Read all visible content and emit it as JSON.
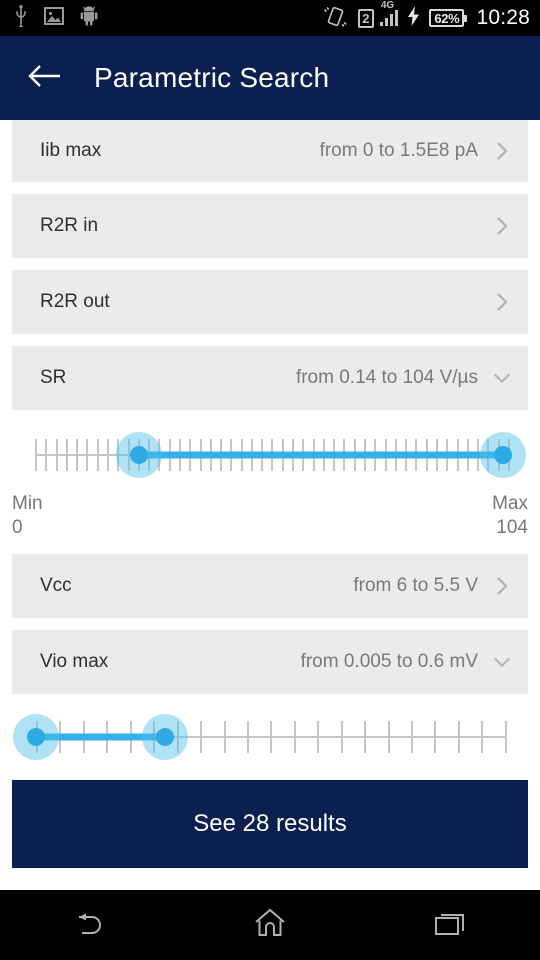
{
  "status_bar": {
    "left_icons": [
      "usb-icon",
      "screenshot-image-icon",
      "android-robot-icon"
    ],
    "vibrate_icon": "vibrate-icon",
    "sim_number": "2",
    "network_type": "4G",
    "charging_icon": "charging-bolt-icon",
    "battery_percent": "62%",
    "time": "10:28"
  },
  "appbar": {
    "back_icon": "back-arrow-icon",
    "title": "Parametric Search",
    "background": "#0b2050"
  },
  "rows": [
    {
      "label": "Iib max",
      "value": "from 0 to 1.5E8 pA",
      "chevron": "chevron-right-icon"
    },
    {
      "label": "R2R in",
      "value": "",
      "chevron": "chevron-right-icon"
    },
    {
      "label": "R2R out",
      "value": "",
      "chevron": "chevron-right-icon"
    },
    {
      "label": "SR",
      "value": "from 0.14 to 104 V/µs",
      "chevron": "chevron-down-icon"
    },
    {
      "label": "Vcc",
      "value": "from 6 to 5.5 V",
      "chevron": "chevron-right-icon"
    },
    {
      "label": "Vio max",
      "value": "from 0.005 to 0.6 mV",
      "chevron": "chevron-down-icon"
    }
  ],
  "slider_sr": {
    "tick_count": 47,
    "left_thumb_pct": 21.8,
    "right_thumb_pct": 98.6,
    "min_label": "Min",
    "min_value": "0",
    "max_label": "Max",
    "max_value": "104",
    "accent": "#2eaae4"
  },
  "slider_vio": {
    "tick_count": 21,
    "left_thumb_pct": 0,
    "right_thumb_pct": 27.4,
    "accent": "#2eaae4"
  },
  "cta": {
    "label": "See 28 results",
    "background": "#0b2050"
  },
  "navbar": {
    "back": "nav-back-icon",
    "home": "nav-home-icon",
    "recents": "nav-recents-icon"
  }
}
